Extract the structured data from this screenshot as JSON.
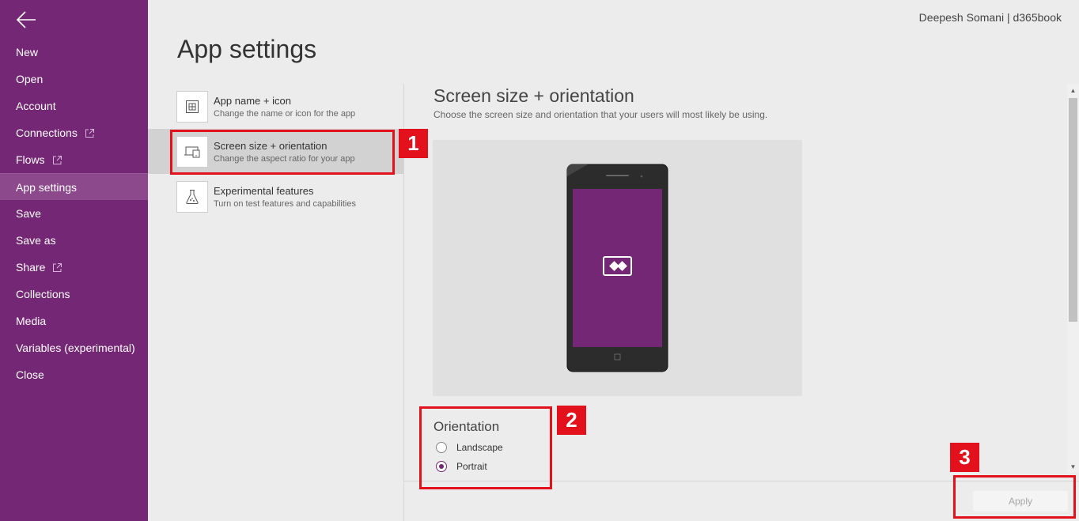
{
  "sidebar": {
    "items": [
      {
        "label": "New",
        "external": false
      },
      {
        "label": "Open",
        "external": false
      },
      {
        "label": "Account",
        "external": false
      },
      {
        "label": "Connections",
        "external": true
      },
      {
        "label": "Flows",
        "external": true
      },
      {
        "label": "App settings",
        "external": false,
        "active": true
      },
      {
        "label": "Save",
        "external": false
      },
      {
        "label": "Save as",
        "external": false
      },
      {
        "label": "Share",
        "external": true
      },
      {
        "label": "Collections",
        "external": false
      },
      {
        "label": "Media",
        "external": false
      },
      {
        "label": "Variables (experimental)",
        "external": false
      },
      {
        "label": "Close",
        "external": false
      }
    ],
    "back_icon": "arrow-left-icon",
    "background_color": "#742774"
  },
  "header": {
    "user": "Deepesh Somani | d365book",
    "title": "App settings"
  },
  "settings": [
    {
      "title": "App name + icon",
      "description": "Change the name or icon for the app",
      "icon": "grid-icon"
    },
    {
      "title": "Screen size + orientation",
      "description": "Change the aspect ratio for your app",
      "icon": "devices-icon",
      "selected": true
    },
    {
      "title": "Experimental features",
      "description": "Turn on test features and capabilities",
      "icon": "flask-icon"
    }
  ],
  "content": {
    "title": "Screen size + orientation",
    "description": "Choose the screen size and orientation that your users will most likely be using.",
    "orientation": {
      "label": "Orientation",
      "options": [
        "Landscape",
        "Portrait"
      ],
      "selected": "Portrait"
    },
    "apply_label": "Apply"
  },
  "annotations": [
    "1",
    "2",
    "3"
  ],
  "colors": {
    "accent": "#742774",
    "annotation": "#e3111c"
  }
}
